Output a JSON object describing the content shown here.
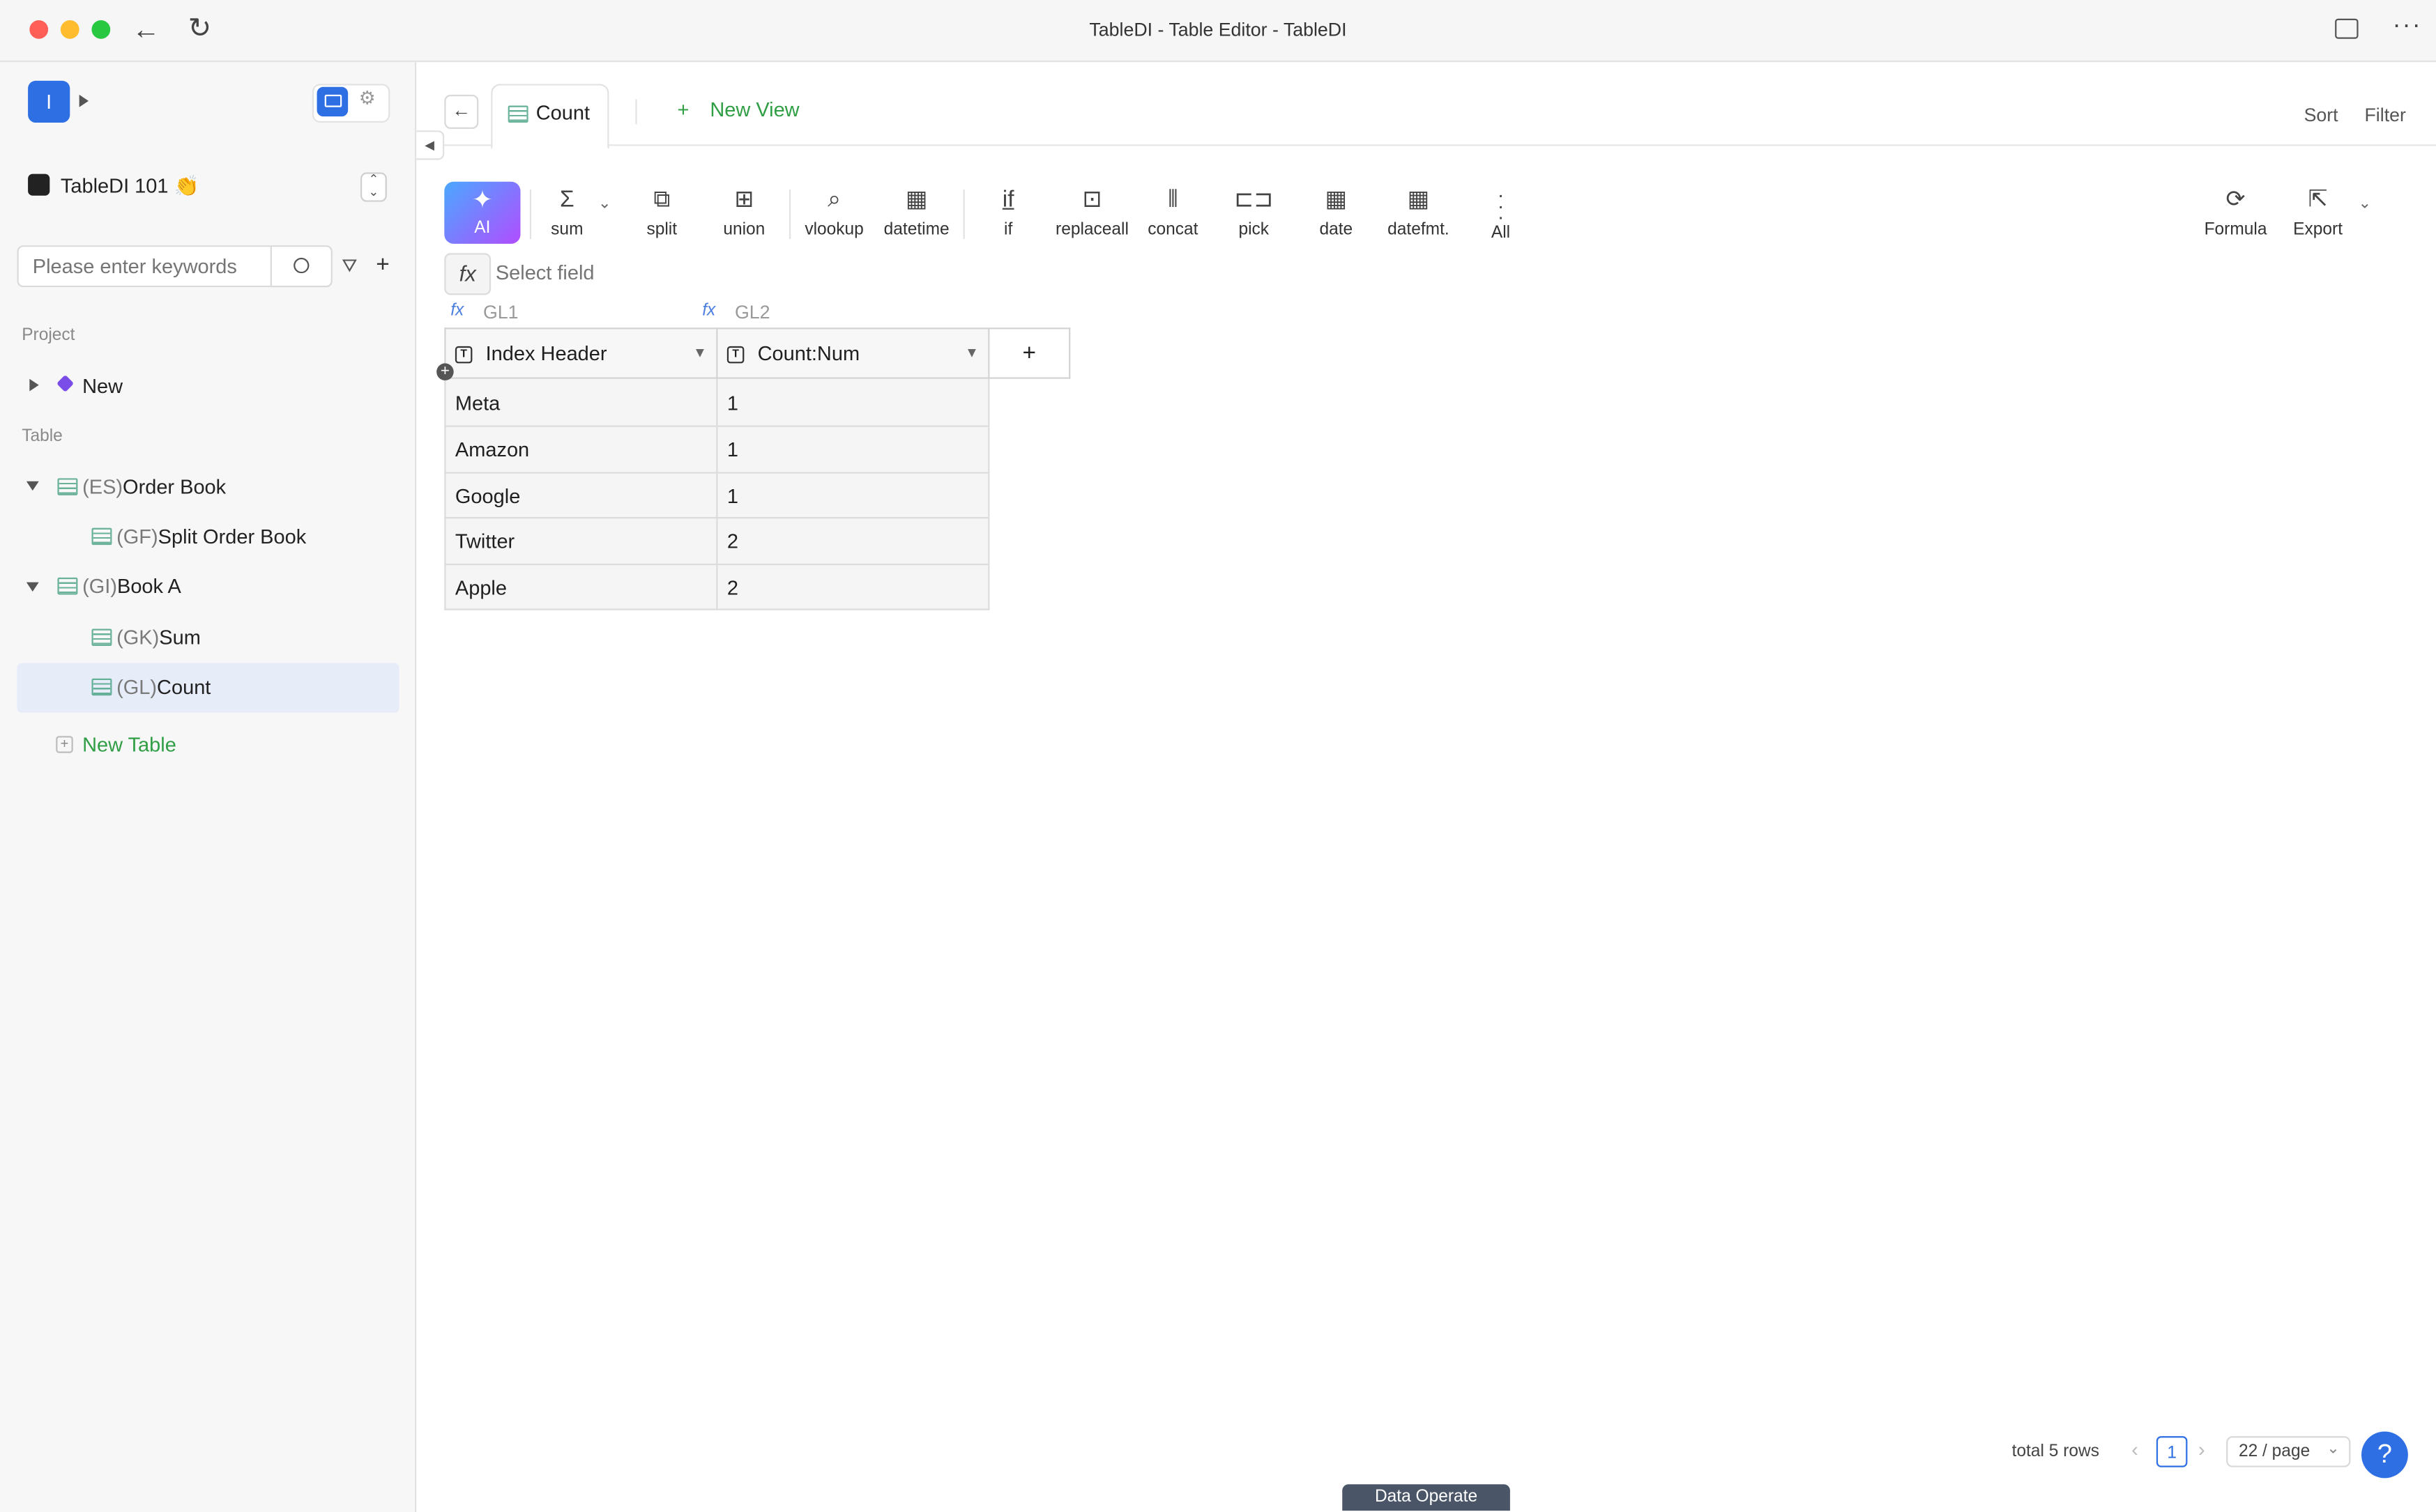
{
  "window": {
    "title": "TableDI - Table Editor - TableDI"
  },
  "sidebar": {
    "avatar_letter": "I",
    "workspace": "TableDI 101 👏",
    "search_placeholder": "Please enter keywords",
    "project_label": "Project",
    "project_item": "New",
    "table_label": "Table",
    "tables": [
      {
        "code": "(ES)",
        "name": "Order Book"
      },
      {
        "code": "(GF)",
        "name": "Split Order Book"
      },
      {
        "code": "(GI)",
        "name": "Book A"
      },
      {
        "code": "(GK)",
        "name": "Sum"
      },
      {
        "code": "(GL)",
        "name": "Count"
      }
    ],
    "new_table": "New Table"
  },
  "tabs": {
    "active": "Count",
    "new_view": "New View",
    "sort": "Sort",
    "filter": "Filter"
  },
  "toolbar": {
    "ai": "AI",
    "tools": [
      "sum",
      "split",
      "union",
      "vlookup",
      "datetime",
      "if",
      "replaceall",
      "concat",
      "pick",
      "date",
      "datefmt.",
      "All"
    ],
    "formula": "Formula",
    "export": "Export"
  },
  "formula_bar": {
    "placeholder": "Select field"
  },
  "grid": {
    "col_ids": [
      "GL1",
      "GL2"
    ],
    "columns": [
      "Index Header",
      "Count:Num"
    ],
    "rows": [
      [
        "Meta",
        "1"
      ],
      [
        "Amazon",
        "1"
      ],
      [
        "Google",
        "1"
      ],
      [
        "Twitter",
        "2"
      ],
      [
        "Apple",
        "2"
      ]
    ]
  },
  "pagination": {
    "total": "total 5 rows",
    "page": "1",
    "page_size": "22 / page"
  },
  "footer": {
    "data_operate": "Data Operate",
    "help": "?"
  },
  "colors": {
    "accent_green": "#2f9e44",
    "brand_blue": "#2f6fe4",
    "ai_gradient_start": "#4aa8ff",
    "ai_gradient_end": "#b14dff"
  }
}
